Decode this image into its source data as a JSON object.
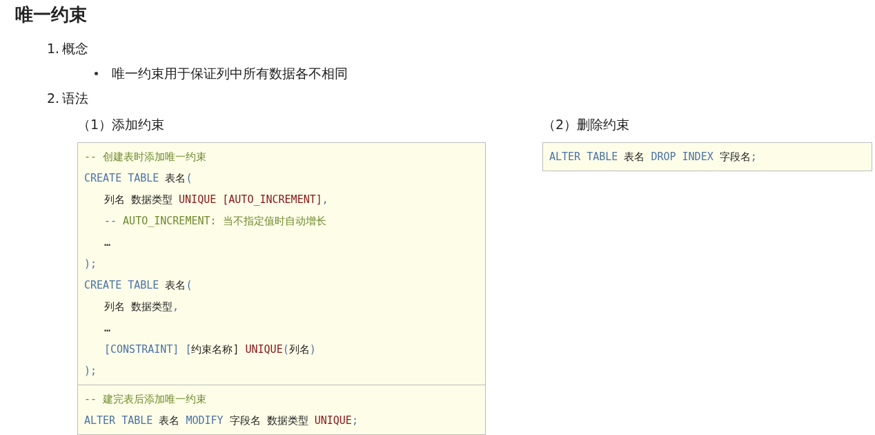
{
  "title": "唯一约束",
  "sections": [
    {
      "number": "1.",
      "label": "概念",
      "bullets": [
        "唯一约束用于保证列中所有数据各不相同"
      ]
    },
    {
      "number": "2.",
      "label": "语法"
    }
  ],
  "columns": [
    {
      "heading": "（1）添加约束",
      "blocks": [
        {
          "lines": [
            {
              "indented": false,
              "tokens": [
                {
                  "kind": "comment",
                  "text": "-- 创建表时添加唯一约束"
                }
              ]
            },
            {
              "indented": false,
              "tokens": [
                {
                  "kind": "keyword",
                  "text": "CREATE TABLE "
                },
                {
                  "kind": "plain",
                  "text": "表名"
                },
                {
                  "kind": "punct",
                  "text": "("
                }
              ]
            },
            {
              "indented": true,
              "tokens": [
                {
                  "kind": "plain",
                  "text": "列名 数据类型 "
                },
                {
                  "kind": "constraint",
                  "text": "UNIQUE [AUTO_INCREMENT]"
                },
                {
                  "kind": "punct",
                  "text": ","
                }
              ]
            },
            {
              "indented": true,
              "tokens": [
                {
                  "kind": "punct",
                  "text": "-- "
                },
                {
                  "kind": "comment",
                  "text": "AUTO_INCREMENT: 当不指定值时自动增长"
                }
              ]
            },
            {
              "indented": true,
              "tokens": [
                {
                  "kind": "plain",
                  "text": "…"
                }
              ]
            },
            {
              "indented": false,
              "tokens": [
                {
                  "kind": "punct",
                  "text": ");"
                }
              ]
            },
            {
              "indented": false,
              "tokens": [
                {
                  "kind": "keyword",
                  "text": "CREATE TABLE "
                },
                {
                  "kind": "plain",
                  "text": "表名"
                },
                {
                  "kind": "punct",
                  "text": "("
                }
              ]
            },
            {
              "indented": true,
              "tokens": [
                {
                  "kind": "plain",
                  "text": "列名 数据类型"
                },
                {
                  "kind": "punct",
                  "text": ","
                }
              ]
            },
            {
              "indented": true,
              "tokens": [
                {
                  "kind": "plain",
                  "text": "…"
                }
              ]
            },
            {
              "indented": true,
              "tokens": [
                {
                  "kind": "keyword",
                  "text": "[CONSTRAINT] ["
                },
                {
                  "kind": "plain",
                  "text": "约束名称] "
                },
                {
                  "kind": "constraint",
                  "text": "UNIQUE"
                },
                {
                  "kind": "punct",
                  "text": "("
                },
                {
                  "kind": "plain",
                  "text": "列名"
                },
                {
                  "kind": "punct",
                  "text": ")"
                }
              ]
            },
            {
              "indented": false,
              "tokens": [
                {
                  "kind": "punct",
                  "text": ");"
                }
              ]
            }
          ]
        },
        {
          "lines": [
            {
              "indented": false,
              "tokens": [
                {
                  "kind": "comment",
                  "text": "-- 建完表后添加唯一约束"
                }
              ]
            },
            {
              "indented": false,
              "tokens": [
                {
                  "kind": "keyword",
                  "text": "ALTER TABLE "
                },
                {
                  "kind": "plain",
                  "text": "表名 "
                },
                {
                  "kind": "keyword",
                  "text": "MODIFY "
                },
                {
                  "kind": "plain",
                  "text": "字段名 数据类型 "
                },
                {
                  "kind": "constraint",
                  "text": "UNIQUE"
                },
                {
                  "kind": "punct",
                  "text": ";"
                }
              ]
            }
          ]
        }
      ]
    },
    {
      "heading": "（2）删除约束",
      "blocks": [
        {
          "lines": [
            {
              "indented": false,
              "tokens": [
                {
                  "kind": "keyword",
                  "text": "ALTER TABLE "
                },
                {
                  "kind": "plain",
                  "text": "表名 "
                },
                {
                  "kind": "keyword",
                  "text": "DROP INDEX "
                },
                {
                  "kind": "plain",
                  "text": "字段名"
                },
                {
                  "kind": "punct",
                  "text": ";"
                }
              ]
            }
          ]
        }
      ]
    }
  ]
}
